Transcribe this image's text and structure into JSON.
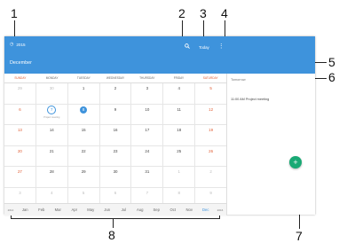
{
  "callouts": [
    "1",
    "2",
    "3",
    "4",
    "5",
    "6",
    "7",
    "8"
  ],
  "header": {
    "year": "2015",
    "month": "December",
    "today_label": "Today",
    "search_icon": "search-icon",
    "more_icon": "more-vert-icon"
  },
  "weekdays": [
    "SUNDAY",
    "MONDAY",
    "TUESDAY",
    "WEDNESDAY",
    "THURSDAY",
    "FRIDAY",
    "SATURDAY"
  ],
  "weeks": [
    [
      "29",
      "30",
      "1",
      "2",
      "3",
      "4",
      "5"
    ],
    [
      "6",
      "7",
      "8",
      "9",
      "10",
      "11",
      "12"
    ],
    [
      "13",
      "14",
      "15",
      "16",
      "17",
      "18",
      "19"
    ],
    [
      "20",
      "21",
      "22",
      "23",
      "24",
      "25",
      "26"
    ],
    [
      "27",
      "28",
      "29",
      "30",
      "31",
      "1",
      "2"
    ],
    [
      "3",
      "4",
      "5",
      "6",
      "7",
      "8",
      "9"
    ]
  ],
  "event_preview": "Project meeting",
  "month_strip": {
    "prev_year": "2014",
    "next_year": "2016",
    "months": [
      "Jan",
      "Feb",
      "Mar",
      "Apr",
      "May",
      "Jun",
      "Jul",
      "Aug",
      "Sep",
      "Oct",
      "Nov",
      "Dec"
    ],
    "active": "Dec"
  },
  "agenda": {
    "date_label": "Tomorrow",
    "event": "11:00 AM Project meeting"
  },
  "fab_label": "+",
  "colors": {
    "primary": "#3e93dc",
    "weekend": "#e05a2f",
    "fab": "#19a974"
  }
}
